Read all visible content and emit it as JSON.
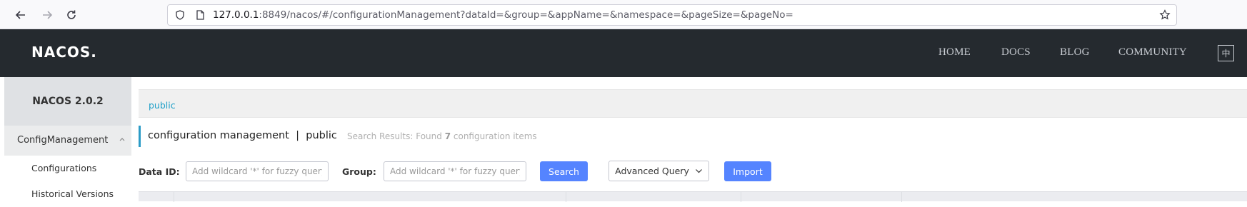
{
  "browser": {
    "url_host": "127.0.0.1",
    "url_rest": ":8849/nacos/#/configurationManagement?dataId=&group=&appName=&namespace=&pageSize=&pageNo="
  },
  "header": {
    "logo": "NACOS.",
    "nav": [
      "HOME",
      "DOCS",
      "BLOG",
      "COMMUNITY"
    ],
    "lang": "中"
  },
  "sidebar": {
    "title": "NACOS 2.0.2",
    "group_label": "ConfigManagement",
    "items": [
      {
        "label": "Configurations"
      },
      {
        "label": "Historical Versions"
      }
    ]
  },
  "main": {
    "namespace": "public",
    "title": "configuration management  |  public",
    "search_result_prefix": "Search Results: Found",
    "search_result_count": "7",
    "search_result_suffix": "configuration items",
    "data_id_label": "Data ID:",
    "data_id_placeholder": "Add wildcard '*' for fuzzy query",
    "group_label": "Group:",
    "group_placeholder": "Add wildcard '*' for fuzzy query",
    "search_button": "Search",
    "advanced_query_button": "Advanced Query",
    "import_button": "Import"
  },
  "colors": {
    "header_bg": "#252a2f",
    "accent": "#5584ff",
    "link": "#20a0c8"
  }
}
